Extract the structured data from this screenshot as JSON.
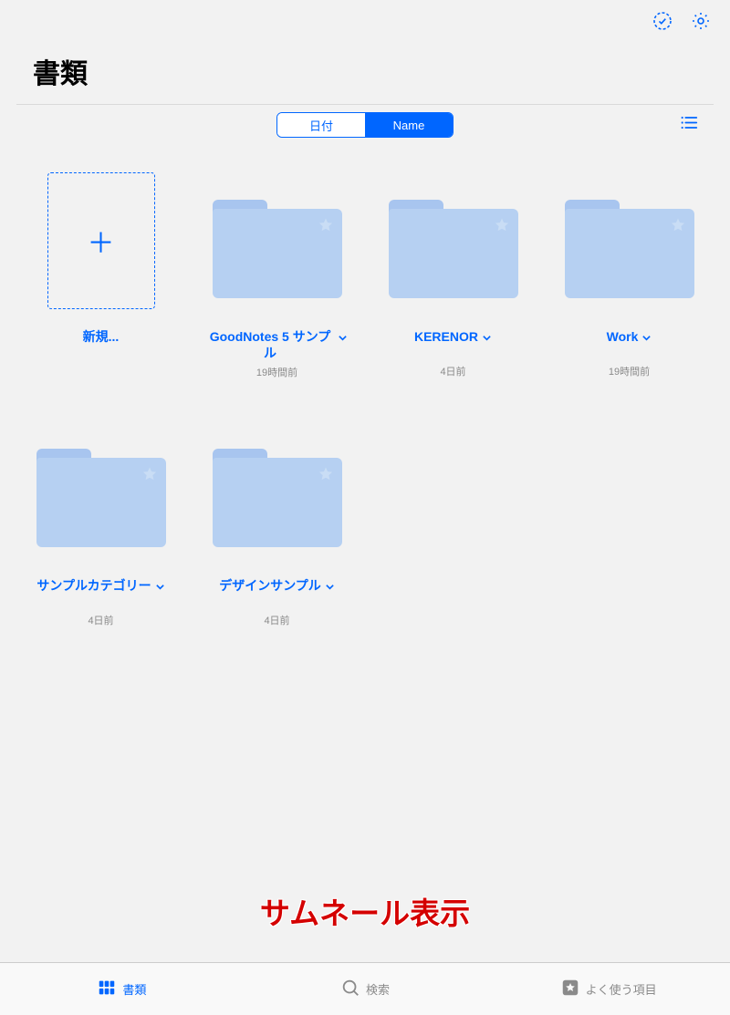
{
  "colors": {
    "accent": "#0066ff",
    "folder": "#b6d0f2",
    "folder_tab": "#a8c5ef",
    "overlay_red": "#d40000"
  },
  "header": {
    "title": "書類"
  },
  "sort": {
    "date_label": "日付",
    "name_label": "Name",
    "active": "name"
  },
  "new_item": {
    "label": "新規..."
  },
  "folders": [
    {
      "name": "GoodNotes 5 サンプル",
      "meta": "19時間前"
    },
    {
      "name": "KERENOR",
      "meta": "4日前"
    },
    {
      "name": "Work",
      "meta": "19時間前"
    },
    {
      "name": "サンプルカテゴリー",
      "meta": "4日前"
    },
    {
      "name": "デザインサンプル",
      "meta": "4日前"
    }
  ],
  "overlay": {
    "text": "サムネール表示"
  },
  "tabs": {
    "documents": "書類",
    "search": "検索",
    "favorites": "よく使う項目"
  }
}
